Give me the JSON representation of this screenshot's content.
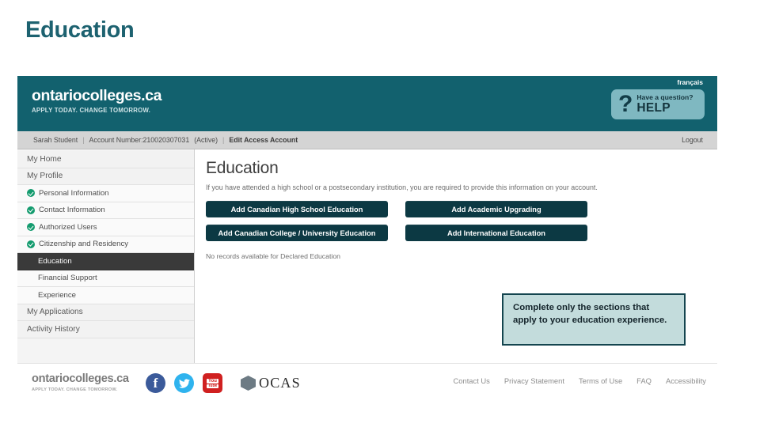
{
  "slide": {
    "title": "Education",
    "title_color": "#1d6270"
  },
  "site": {
    "header": {
      "brand_name": "ontariocolleges.ca",
      "brand_tagline": "APPLY TODAY. CHANGE TOMORROW.",
      "language_link": "français",
      "help_button": {
        "icon": "question-mark-icon",
        "small_label": "Have a question?",
        "big_label": "HELP"
      },
      "bg_color": "#12616e"
    },
    "account_bar": {
      "user_name": "Sarah Student",
      "separator": "|",
      "account_number": "Account Number:210020307031",
      "status": "(Active)",
      "edit_link": "Edit Access Account",
      "logout_link": "Logout"
    },
    "sidebar": {
      "items": [
        {
          "label": "My Home",
          "type": "top",
          "checked": false,
          "active": false
        },
        {
          "label": "My Profile",
          "type": "top",
          "checked": false,
          "active": false
        },
        {
          "label": "Personal Information",
          "type": "sub",
          "checked": true,
          "active": false
        },
        {
          "label": "Contact Information",
          "type": "sub",
          "checked": true,
          "active": false
        },
        {
          "label": "Authorized Users",
          "type": "sub",
          "checked": true,
          "active": false
        },
        {
          "label": "Citizenship and Residency",
          "type": "sub",
          "checked": true,
          "active": false
        },
        {
          "label": "Education",
          "type": "sub",
          "checked": false,
          "active": true
        },
        {
          "label": "Financial Support",
          "type": "sub",
          "checked": false,
          "active": false
        },
        {
          "label": "Experience",
          "type": "sub",
          "checked": false,
          "active": false
        },
        {
          "label": "My Applications",
          "type": "top",
          "checked": false,
          "active": false
        },
        {
          "label": "Activity History",
          "type": "top",
          "checked": false,
          "active": false
        }
      ],
      "active_bg": "#3a3a3a",
      "check_color": "#139b6e"
    },
    "content": {
      "title": "Education",
      "description": "If you have attended a high school or a postsecondary institution, you are required to provide this information on your account.",
      "buttons": [
        "Add Canadian High School Education",
        "Add Academic Upgrading",
        "Add Canadian College / University Education",
        "Add International Education"
      ],
      "button_color": "#0c3943",
      "no_records": "No records available for Declared Education"
    },
    "footer": {
      "brand_name": "ontariocolleges.ca",
      "brand_tagline": "APPLY TODAY. CHANGE TOMORROW.",
      "social": [
        {
          "name": "facebook-icon",
          "glyph": "f",
          "color": "#3b5a9a"
        },
        {
          "name": "twitter-icon",
          "glyph": "▼",
          "color": "#2fb3ee"
        },
        {
          "name": "youtube-icon",
          "glyph": "You Tube",
          "color": "#d02020"
        }
      ],
      "partner_logo": "OCAS",
      "links": [
        "Contact Us",
        "Privacy Statement",
        "Terms of Use",
        "FAQ",
        "Accessibility"
      ]
    }
  },
  "callout": {
    "text": "Complete only the sections that apply to your education experience.",
    "bg_color": "#c3dcdc",
    "border_color": "#14454f"
  }
}
